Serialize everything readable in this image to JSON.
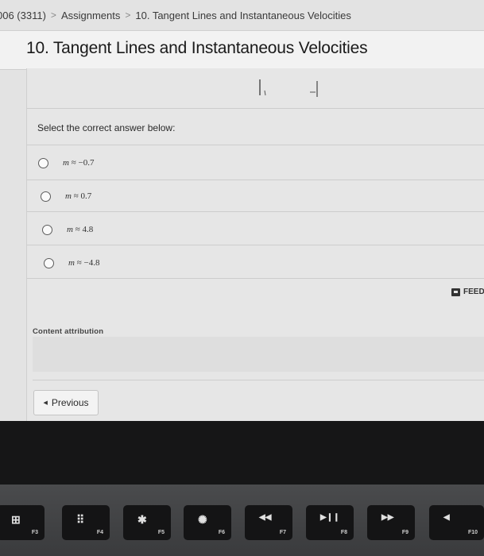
{
  "breadcrumb": {
    "course": "006 (3311)",
    "assignments": "Assignments",
    "current": "10. Tangent Lines and Instantaneous Velocities",
    "separator": ">"
  },
  "page": {
    "title": "10. Tangent Lines and Instantaneous Velocities"
  },
  "question": {
    "prompt": "Select the correct answer below:",
    "choices": [
      {
        "variable": "m",
        "relation": "≈",
        "value": "−0.7"
      },
      {
        "variable": "m",
        "relation": "≈",
        "value": "0.7"
      },
      {
        "variable": "m",
        "relation": "≈",
        "value": "4.8"
      },
      {
        "variable": "m",
        "relation": "≈",
        "value": "−4.8"
      }
    ]
  },
  "feedback": {
    "label": "FEED"
  },
  "attribution": {
    "label": "Content attribution"
  },
  "navigation": {
    "previous_label": "Previous"
  },
  "keyboard": {
    "keys": [
      {
        "fn": "F3",
        "icon": "mission-control-icon",
        "glyph": "⊞"
      },
      {
        "fn": "F4",
        "icon": "launchpad-icon",
        "glyph": "⠿"
      },
      {
        "fn": "F5",
        "icon": "keyboard-dim-icon",
        "glyph": "✱"
      },
      {
        "fn": "F6",
        "icon": "keyboard-bright-icon",
        "glyph": "✺"
      },
      {
        "fn": "F7",
        "icon": "rewind-icon",
        "glyph": "◀◀"
      },
      {
        "fn": "F8",
        "icon": "play-pause-icon",
        "glyph": "▶❙❙"
      },
      {
        "fn": "F9",
        "icon": "fast-forward-icon",
        "glyph": "▶▶"
      },
      {
        "fn": "F10",
        "icon": "mute-icon",
        "glyph": "◀"
      }
    ]
  }
}
